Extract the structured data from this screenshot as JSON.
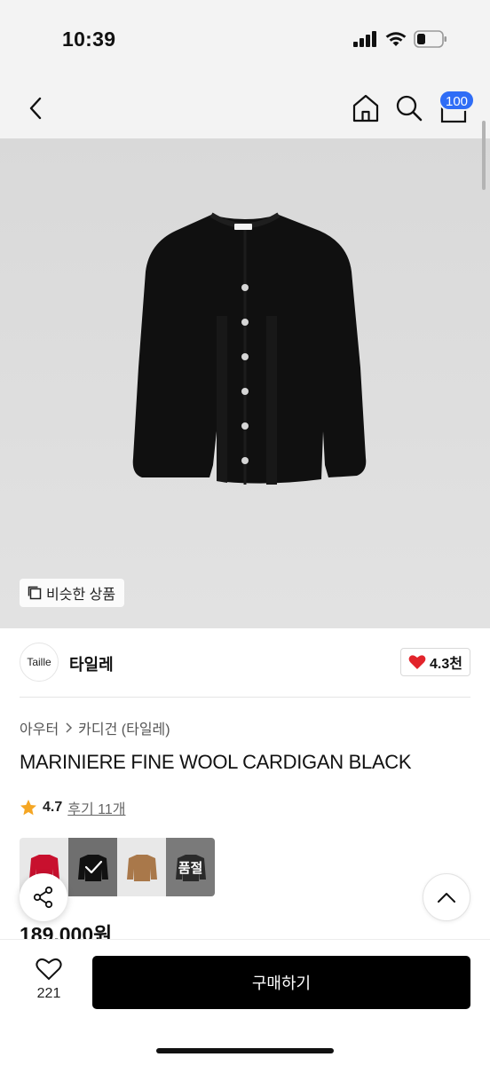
{
  "status_bar": {
    "time": "10:39"
  },
  "nav": {
    "cart_badge": "100"
  },
  "image": {
    "similar_label": "비슷한 상품"
  },
  "brand": {
    "logo_text": "Taille",
    "name": "타일레",
    "likes": "4.3천"
  },
  "breadcrumb": {
    "category": "아우터",
    "subcategory": "카디건 (타일레)"
  },
  "product": {
    "title": "MARINIERE FINE WOOL CARDIGAN BLACK",
    "rating": "4.7",
    "reviews": "후기 11개",
    "price": "189,000원"
  },
  "color_options": [
    {
      "name": "red",
      "color": "#c8102e"
    },
    {
      "name": "black",
      "color": "#111111",
      "selected": true
    },
    {
      "name": "camel",
      "color": "#a9784a"
    },
    {
      "name": "soldout",
      "label": "품절",
      "color": "#2a2a2a"
    }
  ],
  "bottom": {
    "wish_count": "221",
    "buy_label": "구매하기"
  },
  "colors": {
    "accent_blue": "#2f6df6",
    "heart_red": "#e2242b",
    "star_orange": "#f5a623"
  }
}
